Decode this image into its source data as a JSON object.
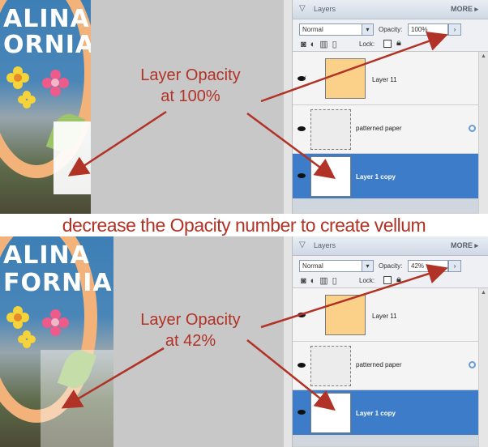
{
  "top": {
    "scrap_title_lines": [
      "ALINA",
      "ORNIA"
    ],
    "annotation_line1": "Layer Opacity",
    "annotation_line2": "at 100%",
    "layers_panel": {
      "title": "Layers",
      "more": "MORE ▸",
      "blend_mode": "Normal",
      "opacity_label": "Opacity:",
      "opacity_value": "100%",
      "lock_label": "Lock:",
      "layers": [
        {
          "name": "Layer 11",
          "selected": false
        },
        {
          "name": "patterned paper",
          "selected": false
        },
        {
          "name": "Layer 1 copy",
          "selected": true
        }
      ]
    }
  },
  "caption": "decrease the Opacity number to create vellum",
  "bottom": {
    "scrap_title_lines": [
      "ALINA",
      "FORNIA"
    ],
    "annotation_line1": "Layer Opacity",
    "annotation_line2": "at 42%",
    "layers_panel": {
      "title": "Layers",
      "more": "MORE ▸",
      "blend_mode": "Normal",
      "opacity_label": "Opacity:",
      "opacity_value": "42%",
      "lock_label": "Lock:",
      "layers": [
        {
          "name": "Layer 11",
          "selected": false
        },
        {
          "name": "patterned paper",
          "selected": false
        },
        {
          "name": "Layer 1 copy",
          "selected": true
        }
      ]
    }
  },
  "colors": {
    "annotation_red": "#b13226",
    "selected_layer_blue": "#3d7cc9"
  }
}
